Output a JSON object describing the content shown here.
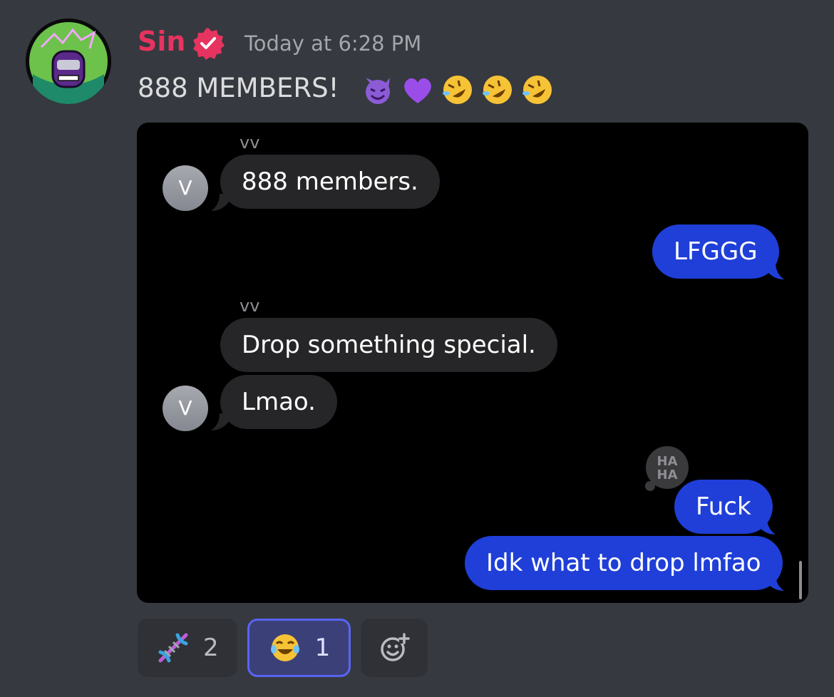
{
  "message": {
    "author": "Sin",
    "timestamp": "Today at 6:28 PM",
    "text": "888 MEMBERS!",
    "emojis": [
      "smiling-imp-icon",
      "purple-heart-icon",
      "rofl-icon",
      "rofl-icon",
      "rofl-icon"
    ]
  },
  "attachment": {
    "conversation": [
      {
        "sender": "vv",
        "text": "888 members.",
        "direction": "incoming",
        "avatar": "V"
      },
      {
        "text": "LFGGG",
        "direction": "outgoing"
      },
      {
        "sender": "vv",
        "text": "Drop something special.",
        "direction": "incoming"
      },
      {
        "text": "Lmao.",
        "direction": "incoming",
        "avatar": "V"
      },
      {
        "text": "Fuck",
        "direction": "outgoing",
        "tapback": "HA HA"
      },
      {
        "text": "Idk what to drop lmfao",
        "direction": "outgoing"
      }
    ],
    "tapback_line1": "HA",
    "tapback_line2": "HA"
  },
  "reactions": [
    {
      "icon": "dna-icon",
      "count": "2",
      "active": false
    },
    {
      "icon": "joy-icon",
      "count": "1",
      "active": true
    }
  ],
  "colors": {
    "author": "#e6335f",
    "outgoing_bubble": "#1f3fd8",
    "incoming_bubble": "#262628",
    "active_reaction_border": "#5865f2"
  }
}
